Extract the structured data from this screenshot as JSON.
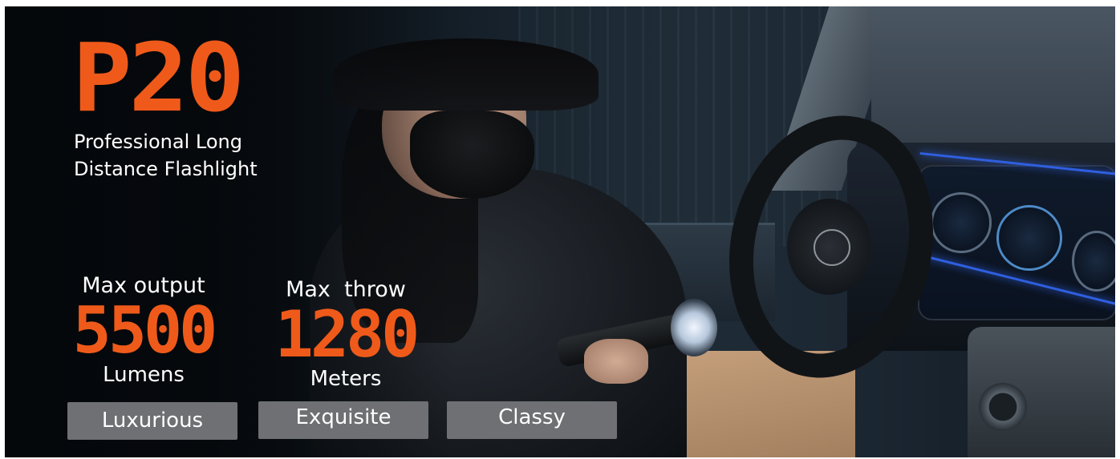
{
  "banner": {
    "title": "P20",
    "subtitle_line1": "Professional Long",
    "subtitle_line2": "Distance Flashlight"
  },
  "stats": {
    "output": {
      "label": "Max output",
      "value": "5500",
      "unit": "Lumens"
    },
    "throw": {
      "label": "Max  throw",
      "value": "1280",
      "unit": "Meters"
    }
  },
  "tags": [
    "Luxurious",
    "Exquisite",
    "Classy"
  ],
  "colors": {
    "accent": "#ef5a1a",
    "tag_bg": "#6e7073",
    "text": "#ffffff"
  }
}
